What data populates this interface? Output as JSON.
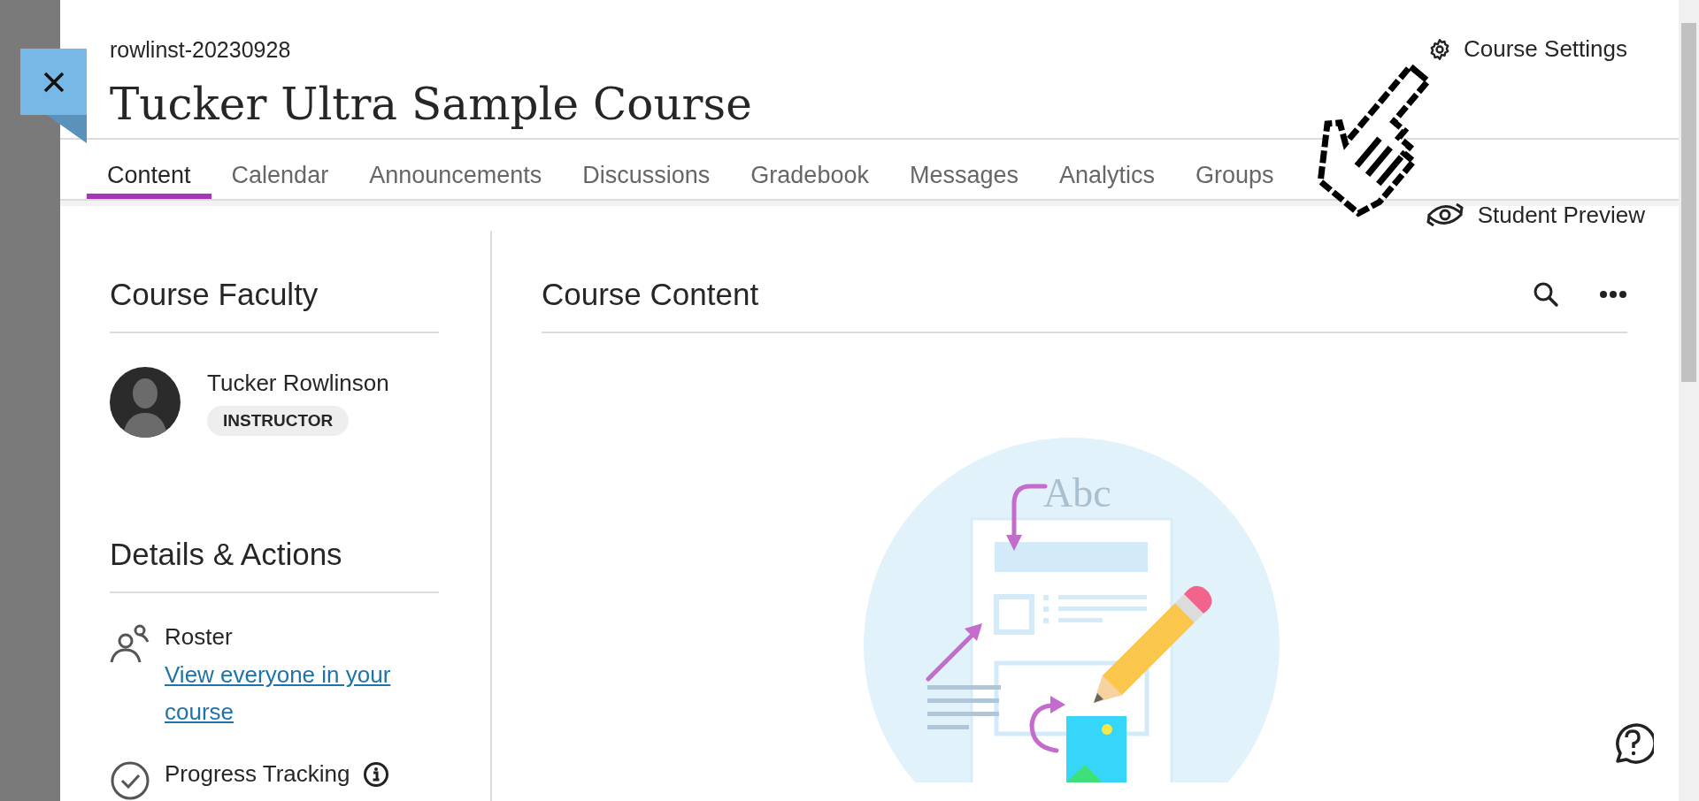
{
  "course": {
    "code": "rowlinst-20230928",
    "title": "Tucker Ultra Sample Course"
  },
  "header_actions": [
    {
      "kind": "settings",
      "label": "Course Settings"
    },
    {
      "kind": "preview",
      "label": "Student Preview"
    }
  ],
  "tabs": [
    {
      "label": "Content",
      "selected": true
    },
    {
      "label": "Calendar",
      "selected": false
    },
    {
      "label": "Announcements",
      "selected": false
    },
    {
      "label": "Discussions",
      "selected": false
    },
    {
      "label": "Gradebook",
      "selected": false
    },
    {
      "label": "Messages",
      "selected": false
    },
    {
      "label": "Analytics",
      "selected": false
    },
    {
      "label": "Groups",
      "selected": false
    }
  ],
  "faculty": {
    "heading": "Course Faculty",
    "members": [
      {
        "name": "Tucker Rowlinson",
        "role": "INSTRUCTOR"
      }
    ]
  },
  "details": {
    "heading": "Details & Actions",
    "items": [
      {
        "kind": "roster",
        "title": "Roster",
        "link": "View everyone in your course"
      },
      {
        "kind": "progress",
        "title": "Progress Tracking",
        "info": true
      }
    ]
  },
  "content": {
    "heading": "Course Content",
    "illustration": {
      "label": "Abc"
    }
  }
}
